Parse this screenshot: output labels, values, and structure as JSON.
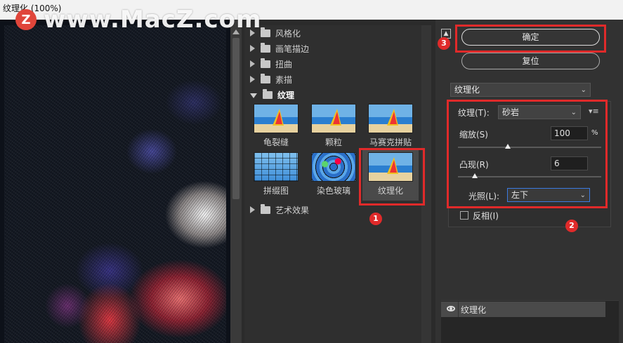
{
  "window": {
    "title": "纹理化 (100%)"
  },
  "watermark": {
    "logo": "Z",
    "text": "www.MacZ.com"
  },
  "gallery": {
    "categories": [
      {
        "label": "风格化",
        "open": false
      },
      {
        "label": "画笔描边",
        "open": false
      },
      {
        "label": "扭曲",
        "open": false
      },
      {
        "label": "素描",
        "open": false
      },
      {
        "label": "纹理",
        "open": true
      },
      {
        "label": "艺术效果",
        "open": false
      }
    ],
    "texture_filters": [
      "龟裂缝",
      "颗粒",
      "马赛克拼贴",
      "拼缀图",
      "染色玻璃",
      "纹理化"
    ],
    "selected": "纹理化"
  },
  "annotations": {
    "b1": "1",
    "b2": "2",
    "b3": "3"
  },
  "buttons": {
    "ok": "确定",
    "reset": "复位"
  },
  "filter_select": {
    "value": "纹理化"
  },
  "params": {
    "texture_label": "纹理(T):",
    "texture_value": "砂岩",
    "scale_label": "缩放(S)",
    "scale_value": "100",
    "scale_unit": "%",
    "scale_fraction": 0.35,
    "relief_label": "凸现(R)",
    "relief_value": "6",
    "relief_fraction": 0.12,
    "light_label": "光照(L):",
    "light_value": "左下",
    "invert_label": "反相(I)",
    "invert_checked": false
  },
  "layers": {
    "name": "纹理化"
  },
  "icons": {
    "collapse": "double-chevron-up-icon",
    "menu": "panel-menu-icon",
    "eye": "eye-icon",
    "folder": "folder-icon"
  }
}
